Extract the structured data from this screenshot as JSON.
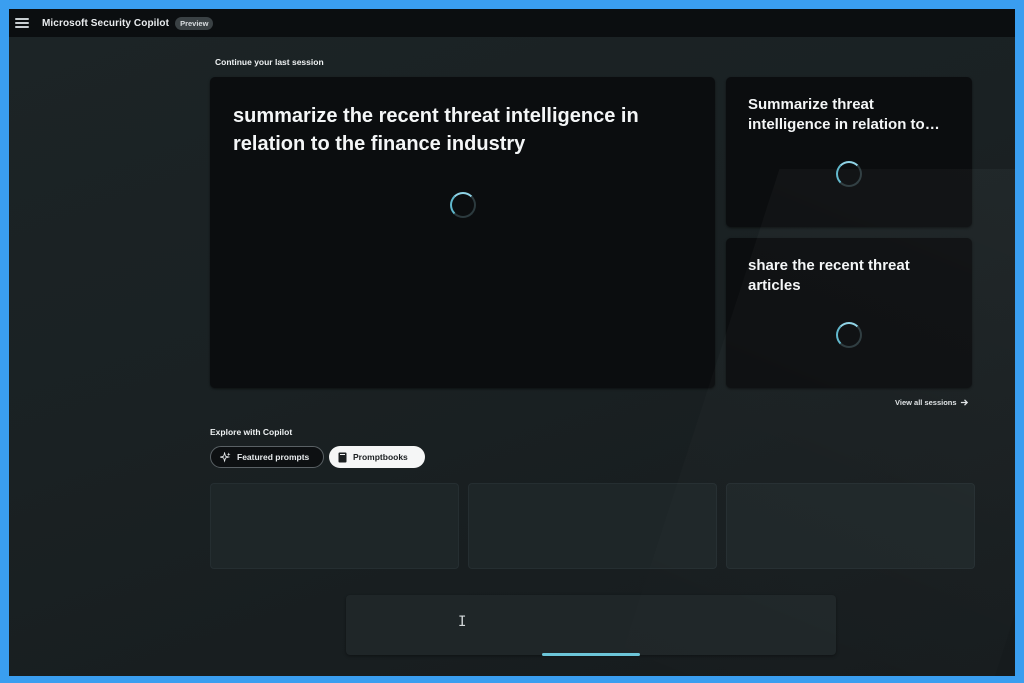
{
  "header": {
    "app_title": "Microsoft Security Copilot",
    "badge": "Preview"
  },
  "sessions": {
    "heading": "Continue your last session",
    "cards": [
      {
        "title": "summarize the recent threat intelligence in relation to the finance industry",
        "status": "loading"
      },
      {
        "title": "Summarize threat intelligence in relation to…",
        "status": "loading"
      },
      {
        "title": "share the recent threat articles",
        "status": "loading"
      }
    ],
    "view_all_label": "View all sessions"
  },
  "explore": {
    "heading": "Explore with Copilot",
    "chips": [
      {
        "label": "Featured prompts",
        "icon": "sparkle-icon",
        "selected": false
      },
      {
        "label": "Promptbooks",
        "icon": "book-icon",
        "selected": true
      }
    ]
  },
  "prompt_input": {
    "value": "",
    "cursor": "I"
  },
  "colors": {
    "frame": "#3a9ef0",
    "background": "#1a2123",
    "card": "#0b0d0f",
    "accent": "#6cc5d8"
  }
}
